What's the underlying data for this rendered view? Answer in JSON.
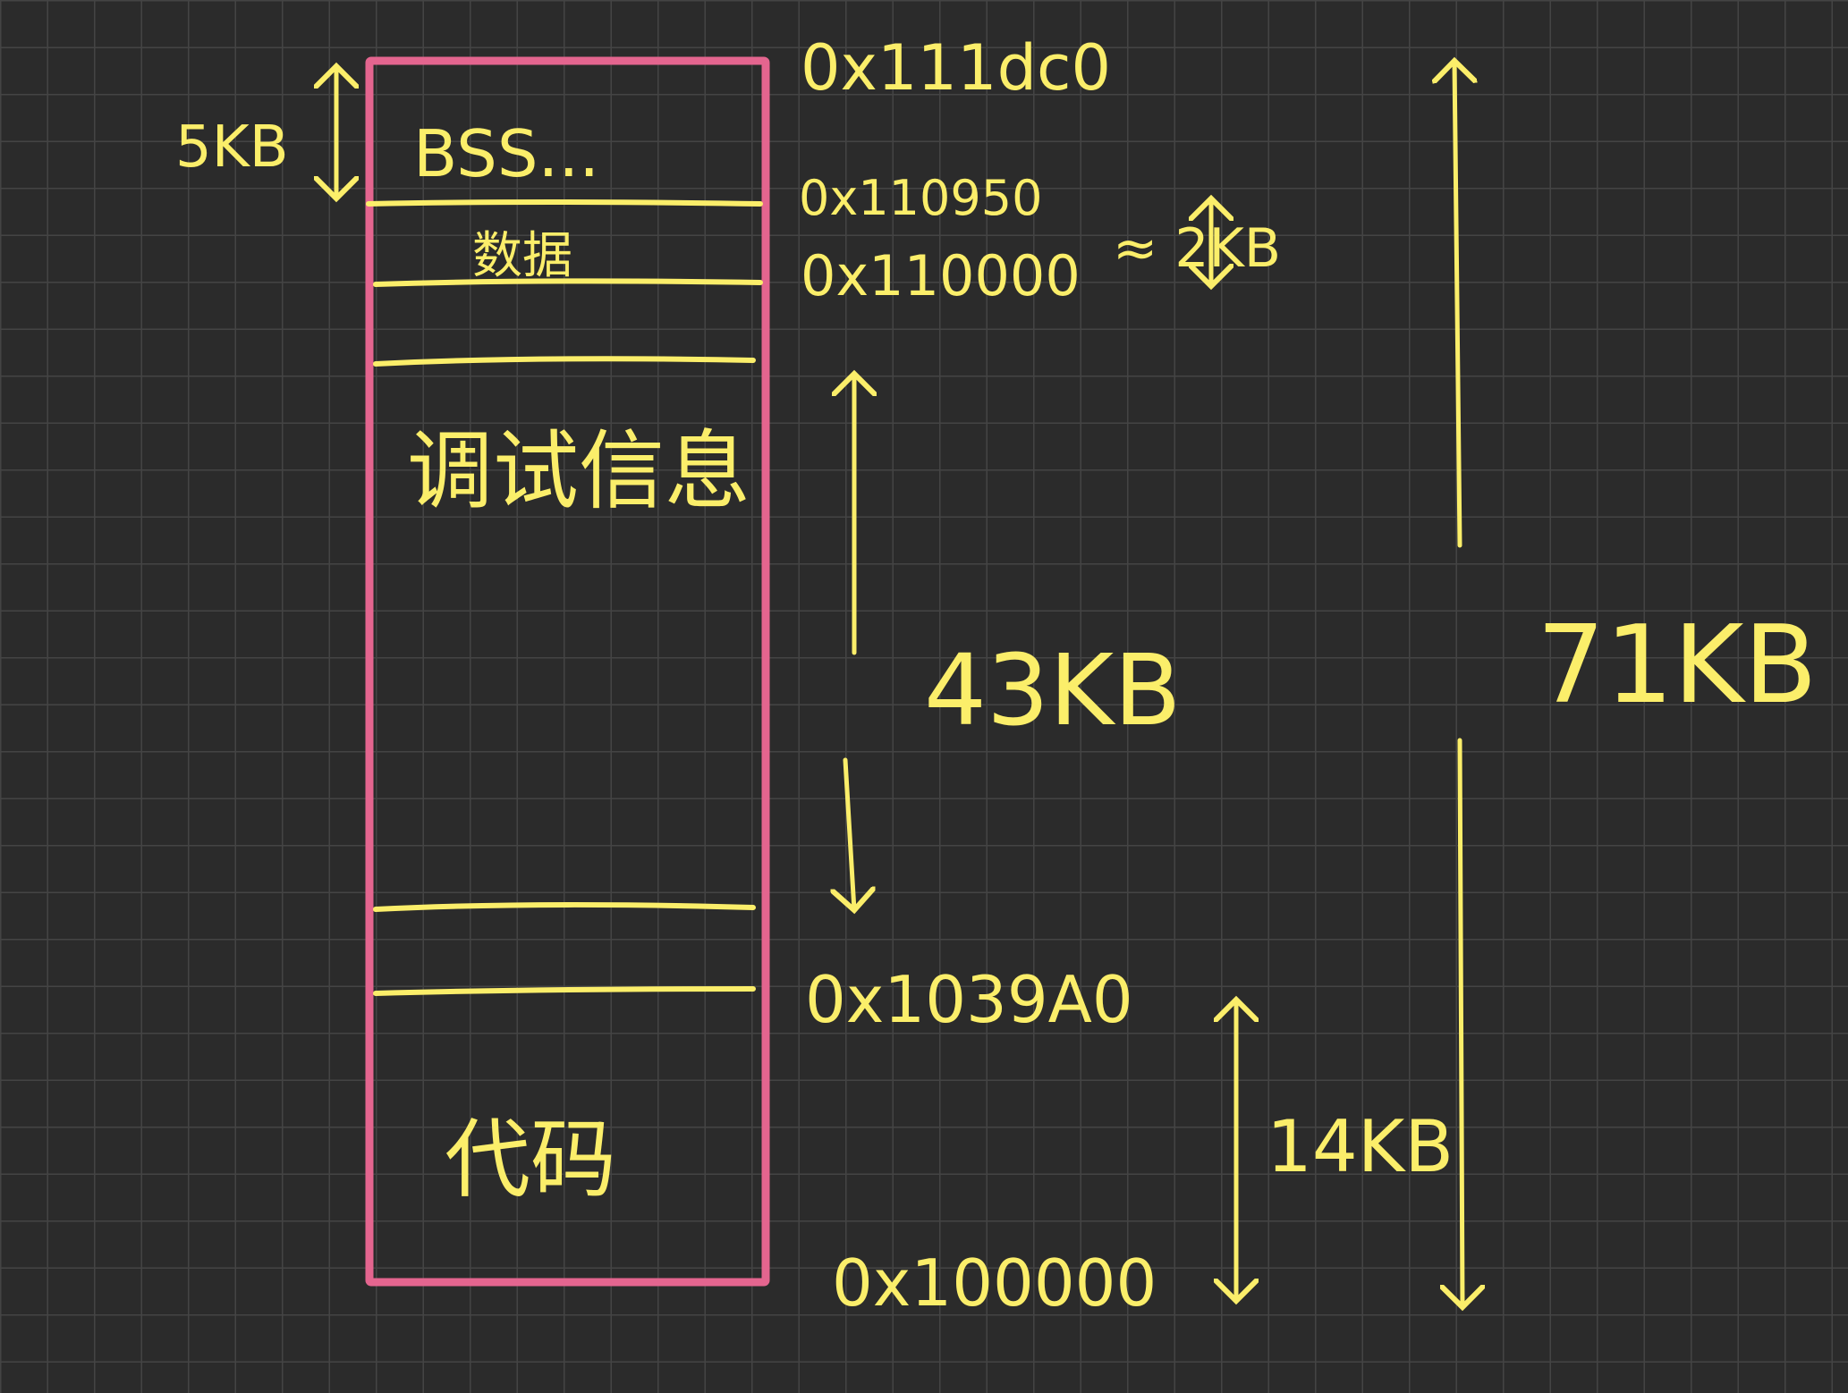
{
  "colors": {
    "background": "#2b2b2b",
    "grid": "#444444",
    "box": "#e4658f",
    "ink": "#fbee6a"
  },
  "segments": {
    "bss": "BSS...",
    "data": "数据",
    "debug": "调试信息",
    "code": "代码"
  },
  "addresses": {
    "top": "0x111dc0",
    "bss_start": "0x110950",
    "data_start": "0x110000",
    "code_end": "0x1039A0",
    "base": "0x100000"
  },
  "sizes": {
    "bss": "5KB",
    "data": "≈ 2KB",
    "debug": "43KB",
    "code": "14KB",
    "total": "71KB"
  }
}
